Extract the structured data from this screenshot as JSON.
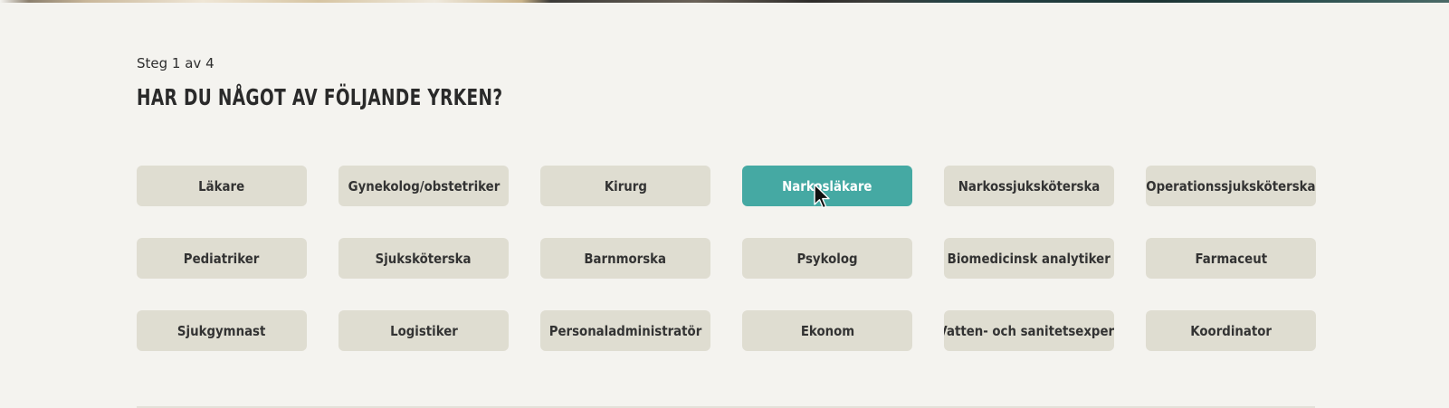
{
  "step": {
    "label": "Steg 1 av 4"
  },
  "question": {
    "title": "HAR DU NÅGOT AV FÖLJANDE YRKEN?"
  },
  "colors": {
    "background": "#f4f3ef",
    "option_default": "#dfddd1",
    "option_selected": "#45a9a3",
    "option_text": "#333333",
    "option_selected_text": "#ffffff"
  },
  "options": [
    {
      "label": "Läkare",
      "selected": false
    },
    {
      "label": "Gynekolog/obstetriker",
      "selected": false
    },
    {
      "label": "Kirurg",
      "selected": false
    },
    {
      "label": "Narkosläkare",
      "selected": true
    },
    {
      "label": "Narkossjuksköterska",
      "selected": false
    },
    {
      "label": "Operationssjuksköterska",
      "selected": false
    },
    {
      "label": "Pediatriker",
      "selected": false
    },
    {
      "label": "Sjuksköterska",
      "selected": false
    },
    {
      "label": "Barnmorska",
      "selected": false
    },
    {
      "label": "Psykolog",
      "selected": false
    },
    {
      "label": "Biomedicinsk analytiker",
      "selected": false
    },
    {
      "label": "Farmaceut",
      "selected": false
    },
    {
      "label": "Sjukgymnast",
      "selected": false
    },
    {
      "label": "Logistiker",
      "selected": false
    },
    {
      "label": "Personaladministratör",
      "selected": false
    },
    {
      "label": "Ekonom",
      "selected": false
    },
    {
      "label": "Vatten- och sanitetsexpert",
      "selected": false
    },
    {
      "label": "Koordinator",
      "selected": false
    }
  ],
  "cursor": {
    "icon": "mouse-pointer-icon"
  }
}
